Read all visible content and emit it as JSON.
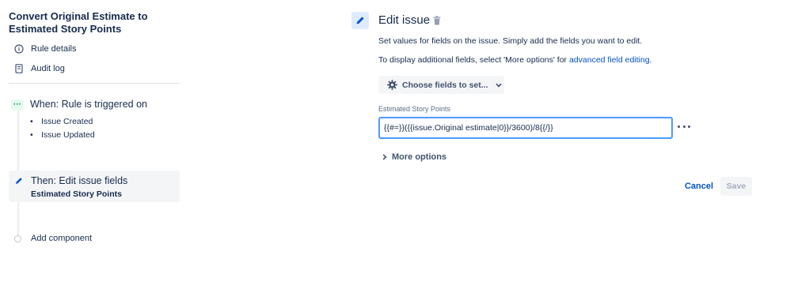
{
  "rule": {
    "title": "Convert Original Estimate to Estimated Story Points"
  },
  "sidebar": {
    "links": [
      {
        "label": "Rule details",
        "icon": "info-icon"
      },
      {
        "label": "Audit log",
        "icon": "document-icon"
      }
    ]
  },
  "trigger": {
    "title": "When: Rule is triggered on",
    "items": [
      "Issue Created",
      "Issue Updated"
    ],
    "badge_color": "#00875a"
  },
  "action": {
    "title": "Then: Edit issue fields",
    "subtitle": "Estimated Story Points"
  },
  "add_component": {
    "label": "Add component"
  },
  "editor": {
    "title": "Edit issue",
    "description_1": "Set values for fields on the issue. Simply add the fields you want to edit.",
    "description_2_prefix": "To display additional fields, select 'More options' for ",
    "description_2_link": "advanced field editing",
    "description_2_suffix": ".",
    "choose_fields_label": "Choose fields to set...",
    "field_label": "Estimated Story Points",
    "field_value": "{{#=}}({{issue.Original estimate|0}}/3600)/8{{/}}",
    "more_options_label": "More options",
    "cancel_label": "Cancel",
    "save_label": "Save"
  },
  "colors": {
    "accent": "#0052cc",
    "focus_border": "#4c9aff",
    "selected_bg": "#f4f5f7"
  }
}
